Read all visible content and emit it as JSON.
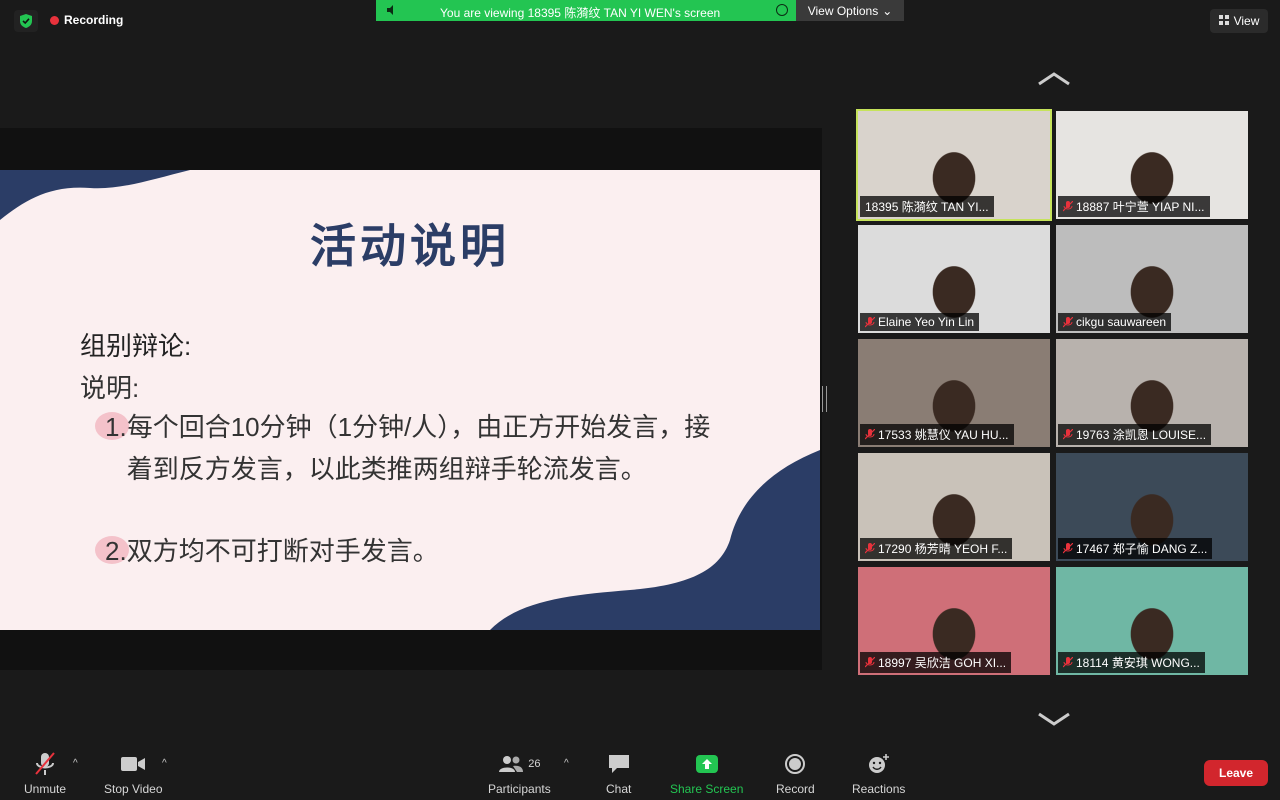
{
  "top": {
    "recording_label": "Recording",
    "banner_text": "You are viewing 18395 陈漪纹 TAN YI WEN's screen",
    "view_options_label": "View Options",
    "view_label": "View"
  },
  "slide": {
    "title": "活动说明",
    "heading": "组别辩论:",
    "subheading": "说明:",
    "items": [
      {
        "num": "1.",
        "text": "每个回合10分钟（1分钟/人），由正方开始发言，接着到反方发言，以此类推两组辩手轮流发言。"
      },
      {
        "num": "2.",
        "text": "双方均不可打断对手发言。"
      }
    ]
  },
  "participants": [
    {
      "name": "18395 陈漪纹 TAN YI...",
      "muted": false,
      "active": true,
      "bg": "#d9d3cc"
    },
    {
      "name": "18887 叶宁萱 YIAP NI...",
      "muted": true,
      "active": false,
      "bg": "#e6e4e1"
    },
    {
      "name": "Elaine Yeo Yin Lin",
      "muted": true,
      "active": false,
      "bg": "#dcdcdc"
    },
    {
      "name": "cikgu sauwareen",
      "muted": true,
      "active": false,
      "bg": "#bdbdbd"
    },
    {
      "name": "17533 姚慧仪 YAU HU...",
      "muted": true,
      "active": false,
      "bg": "#8a7d74"
    },
    {
      "name": "19763 涂凯恩 LOUISE...",
      "muted": true,
      "active": false,
      "bg": "#b8b2ad"
    },
    {
      "name": "17290 杨芳晴 YEOH F...",
      "muted": true,
      "active": false,
      "bg": "#c9c2b9"
    },
    {
      "name": "17467 郑子愉 DANG Z...",
      "muted": true,
      "active": false,
      "bg": "#3c4a58"
    },
    {
      "name": "18997 吴欣洁 GOH XI...",
      "muted": true,
      "active": false,
      "bg": "#cf6f78"
    },
    {
      "name": "18114 黄安琪 WONG...",
      "muted": true,
      "active": false,
      "bg": "#6fb7a4"
    }
  ],
  "toolbar": {
    "unmute": "Unmute",
    "stop_video": "Stop Video",
    "participants": "Participants",
    "participant_count": "26",
    "chat": "Chat",
    "share_screen": "Share Screen",
    "record": "Record",
    "reactions": "Reactions",
    "leave": "Leave"
  },
  "colors": {
    "accent_green": "#23c552",
    "leave_red": "#d2262d",
    "active_speaker": "#c6e35b",
    "slide_navy": "#2b3d66"
  }
}
